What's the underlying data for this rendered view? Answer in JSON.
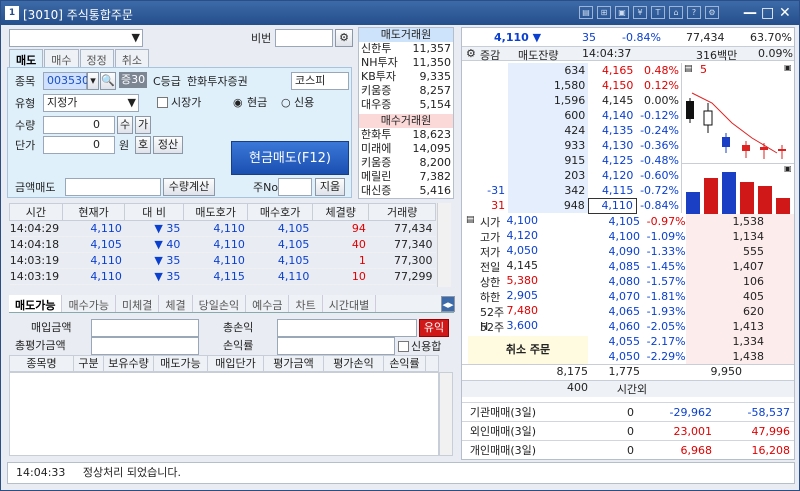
{
  "window": {
    "title": "[3010]  주식통합주문",
    "app_icon": "1",
    "tool_icons": [
      "tool-icon-1",
      "tool-icon-2",
      "tool-icon-3",
      "tool-icon-4",
      "tool-icon-5",
      "tool-icon-6",
      "tool-icon-7",
      "tool-icon-8"
    ],
    "min": "—",
    "max": "□",
    "close": "✕"
  },
  "account": {
    "password_label": "비번"
  },
  "tabs": [
    "매도",
    "매수",
    "정정",
    "취소"
  ],
  "order": {
    "code_label": "종목",
    "code_value": "003530",
    "code_pct": "증30",
    "grade": "C등급",
    "stock_name": "한화투자증권",
    "market": "코스피",
    "type_label": "유형",
    "type_value": "지정가",
    "market_price_label": "시장가",
    "cash_label": "현금",
    "credit_label": "신용",
    "qty_label": "수량",
    "qty_value": "0",
    "qty_btn1": "수",
    "qty_btn2": "가",
    "price_label": "단가",
    "price_value": "0",
    "won": "원",
    "price_btn1": "호",
    "price_btn2": "정산",
    "sell_button": "현금매도(F12)",
    "amount_label": "금액매도",
    "calc_btn": "수량계산",
    "weekno_label": "주No",
    "clear_btn": "지움"
  },
  "brokers": {
    "sell_header": "매도거래원",
    "sell": [
      [
        "신한투",
        "11,357"
      ],
      [
        "NH투자",
        "11,350"
      ],
      [
        "KB투자",
        "9,335"
      ],
      [
        "키움증",
        "8,257"
      ],
      [
        "대우증",
        "5,154"
      ]
    ],
    "buy_header": "매수거래원",
    "buy": [
      [
        "한화투",
        "18,623"
      ],
      [
        "미래에",
        "14,095"
      ],
      [
        "키움증",
        "8,200"
      ],
      [
        "메릴린",
        "7,382"
      ],
      [
        "대신증",
        "5,416"
      ]
    ]
  },
  "trades": {
    "headers": [
      "시간",
      "현재가",
      "대  비",
      "매도호가",
      "매수호가",
      "체결량",
      "거래량"
    ],
    "rows": [
      [
        "14:04:29",
        "4,110",
        "▼",
        "35",
        "4,110",
        "4,105",
        "94",
        "77,434"
      ],
      [
        "14:04:18",
        "4,105",
        "▼",
        "40",
        "4,110",
        "4,105",
        "40",
        "77,340"
      ],
      [
        "14:03:19",
        "4,110",
        "▼",
        "35",
        "4,110",
        "4,105",
        "1",
        "77,300"
      ],
      [
        "14:03:19",
        "4,110",
        "▼",
        "35",
        "4,115",
        "4,110",
        "10",
        "77,299"
      ]
    ]
  },
  "bottom_tabs": [
    "매도가능",
    "매수가능",
    "미체결",
    "체결",
    "당일손익",
    "예수금",
    "차트",
    "시간대별"
  ],
  "summary": {
    "buy_amt": "매입금액",
    "total_pl": "총손익",
    "eval_amt": "총평가금액",
    "pl_rate": "손익률",
    "yuik": "유익",
    "credit_check": "신용합"
  },
  "holdings_headers": [
    "종목명",
    "구분",
    "보유수량",
    "매도가능",
    "매입단가",
    "평가금액",
    "평가손익",
    "손익률"
  ],
  "status": {
    "time": "14:04:33",
    "message": "정상처리 되었습니다."
  },
  "quote": {
    "price": "4,110",
    "arrow": "▼",
    "change": "35",
    "change_pct": "-0.84%",
    "volume": "77,434",
    "vol_ratio": "63.70%",
    "col_change": "증감",
    "col_sellrem": "매도잔량",
    "time": "14:04:37",
    "amount": "316백만",
    "amount_pct": "0.09%",
    "asks": [
      [
        "634",
        "4,165",
        "0.48%"
      ],
      [
        "1,580",
        "4,150",
        "0.12%"
      ],
      [
        "1,596",
        "4,145",
        "0.00%"
      ],
      [
        "600",
        "4,140",
        "-0.12%"
      ],
      [
        "424",
        "4,135",
        "-0.24%"
      ],
      [
        "933",
        "4,130",
        "-0.36%"
      ],
      [
        "915",
        "4,125",
        "-0.48%"
      ],
      [
        "203",
        "4,120",
        "-0.60%"
      ],
      [
        "342",
        "4,115",
        "-0.72%"
      ],
      [
        "948",
        "4,110",
        "-0.84%"
      ]
    ],
    "ask_changes": [
      "",
      "",
      "",
      "",
      "",
      "",
      "",
      "",
      "-31",
      "31"
    ],
    "chart_label": "5",
    "bids": [
      [
        "4,105",
        "-0.97%",
        "1,538"
      ],
      [
        "4,100",
        "-1.09%",
        "1,134"
      ],
      [
        "4,090",
        "-1.33%",
        "555"
      ],
      [
        "4,085",
        "-1.45%",
        "1,407"
      ],
      [
        "4,080",
        "-1.57%",
        "106"
      ],
      [
        "4,070",
        "-1.81%",
        "405"
      ],
      [
        "4,065",
        "-1.93%",
        "620"
      ],
      [
        "4,060",
        "-2.05%",
        "1,413"
      ],
      [
        "4,055",
        "-2.17%",
        "1,334"
      ],
      [
        "4,050",
        "-2.29%",
        "1,438"
      ]
    ],
    "info": [
      [
        "시가",
        "4,100"
      ],
      [
        "고가",
        "4,120"
      ],
      [
        "저가",
        "4,050"
      ],
      [
        "전일",
        "4,145"
      ],
      [
        "상한",
        "5,380"
      ],
      [
        "하한",
        "2,905"
      ],
      [
        "52주H",
        "7,480"
      ],
      [
        "52주L",
        "3,600"
      ]
    ],
    "cancel_order": "취소 주문",
    "total_ask": "8,175",
    "total_ask2": "1,775",
    "total_bid": "9,950",
    "after_ask": "400",
    "after_label": "시간외",
    "flows": [
      [
        "기관매매(3일)",
        "0",
        "-29,962",
        "-58,537"
      ],
      [
        "외인매매(3일)",
        "0",
        "23,001",
        "47,996"
      ],
      [
        "개인매매(3일)",
        "0",
        "6,968",
        "16,208"
      ]
    ]
  }
}
